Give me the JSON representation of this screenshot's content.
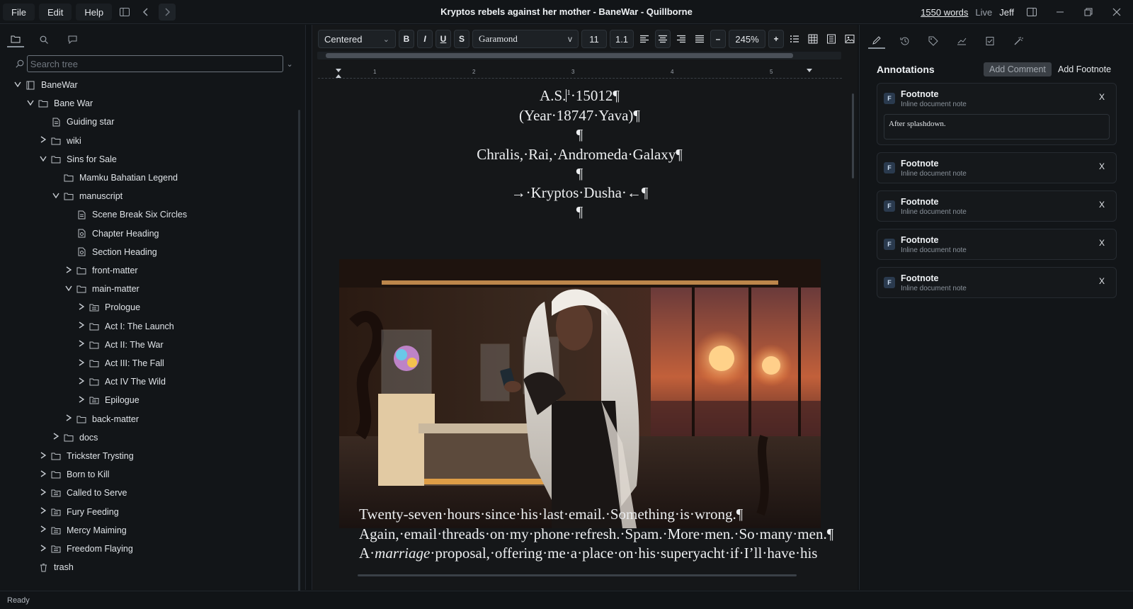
{
  "titlebar": {
    "menus": [
      "File",
      "Edit",
      "Help"
    ],
    "window_title": "Kryptos rebels against her mother - BaneWar - Quillborne",
    "word_count": "1550 words",
    "mode": "Live",
    "user": "Jeff"
  },
  "sidebar": {
    "search_placeholder": "Search tree",
    "tree": [
      {
        "label": "BaneWar",
        "icon": "book-icon",
        "chevron": "v"
      },
      {
        "label": "Bane War",
        "icon": "folder-icon",
        "chevron": "v"
      },
      {
        "label": "Guiding star",
        "icon": "document-icon",
        "chevron": ""
      },
      {
        "label": "wiki",
        "icon": "folder-icon",
        "chevron": ">"
      },
      {
        "label": "Sins for Sale",
        "icon": "folder-icon",
        "chevron": "v"
      },
      {
        "label": "Mamku Bahatian Legend",
        "icon": "folder-icon",
        "chevron": ""
      },
      {
        "label": "manuscript",
        "icon": "folder-icon",
        "chevron": "v"
      },
      {
        "label": "Scene Break Six Circles",
        "icon": "document-icon",
        "chevron": ""
      },
      {
        "label": "Chapter Heading",
        "icon": "template-icon",
        "chevron": ""
      },
      {
        "label": "Section Heading",
        "icon": "template-icon",
        "chevron": ""
      },
      {
        "label": "front-matter",
        "icon": "folder-icon",
        "chevron": ">"
      },
      {
        "label": "main-matter",
        "icon": "folder-icon",
        "chevron": "v"
      },
      {
        "label": "Prologue",
        "icon": "chapter-folder-icon",
        "chevron": ">"
      },
      {
        "label": "Act I: The Launch",
        "icon": "folder-icon",
        "chevron": ">"
      },
      {
        "label": "Act II: The War",
        "icon": "folder-icon",
        "chevron": ">"
      },
      {
        "label": "Act III: The Fall",
        "icon": "folder-icon",
        "chevron": ">"
      },
      {
        "label": "Act IV The Wild",
        "icon": "folder-icon",
        "chevron": ">"
      },
      {
        "label": "Epilogue",
        "icon": "chapter-folder-icon",
        "chevron": ">"
      },
      {
        "label": "back-matter",
        "icon": "folder-icon",
        "chevron": ">"
      },
      {
        "label": "docs",
        "icon": "folder-icon",
        "chevron": ">"
      },
      {
        "label": "Trickster Trysting",
        "icon": "folder-icon",
        "chevron": ">"
      },
      {
        "label": "Born to Kill",
        "icon": "folder-icon",
        "chevron": ">"
      },
      {
        "label": "Called to Serve",
        "icon": "chapter-folder-icon",
        "chevron": ">"
      },
      {
        "label": "Fury Feeding",
        "icon": "chapter-folder-icon",
        "chevron": ">"
      },
      {
        "label": "Mercy Maiming",
        "icon": "chapter-folder-icon",
        "chevron": ">"
      },
      {
        "label": "Freedom Flaying",
        "icon": "chapter-folder-icon",
        "chevron": ">"
      },
      {
        "label": "trash",
        "icon": "trash-icon",
        "chevron": ""
      }
    ]
  },
  "toolbar": {
    "paragraph_style": "Centered",
    "bold": "B",
    "italic": "I",
    "underline": "U",
    "strike": "S",
    "font": "Garamond",
    "font_size": "11",
    "line_height": "1.1",
    "zoom": "245%",
    "zoom_out": "–",
    "zoom_in": "+",
    "dropdown_v": "v"
  },
  "document": {
    "line1_a": "A.S.",
    "line1_sup": "1",
    "line1_b": "·15012¶",
    "line2": "(Year·18747·Yava)¶",
    "pilcrow": "¶",
    "line3": "Chralis,·Rai,·Andromeda·Galaxy¶",
    "line4": "→·Kryptos·Dusha·←¶",
    "para1": "Twenty-seven·hours·since·his·last·email.·Something·is·wrong.¶",
    "para2": "Again,·email·threads·on·my·phone·refresh.·Spam.·More·men.·So·many·men.¶",
    "para3_a": "A·",
    "para3_em": "marriage",
    "para3_b": "·proposal,·offering·me·a·place·on·his·superyacht·if·I’ll·have·his"
  },
  "annotations": {
    "title": "Annotations",
    "add_comment": "Add Comment",
    "add_footnote": "Add Footnote",
    "cards": [
      {
        "badge": "F",
        "title": "Footnote",
        "subtitle": "Inline document note",
        "close": "X",
        "note": "After splashdown."
      },
      {
        "badge": "F",
        "title": "Footnote",
        "subtitle": "Inline document note",
        "close": "X"
      },
      {
        "badge": "F",
        "title": "Footnote",
        "subtitle": "Inline document note",
        "close": "X"
      },
      {
        "badge": "F",
        "title": "Footnote",
        "subtitle": "Inline document note",
        "close": "X"
      },
      {
        "badge": "F",
        "title": "Footnote",
        "subtitle": "Inline document note",
        "close": "X"
      }
    ]
  },
  "status": "Ready"
}
